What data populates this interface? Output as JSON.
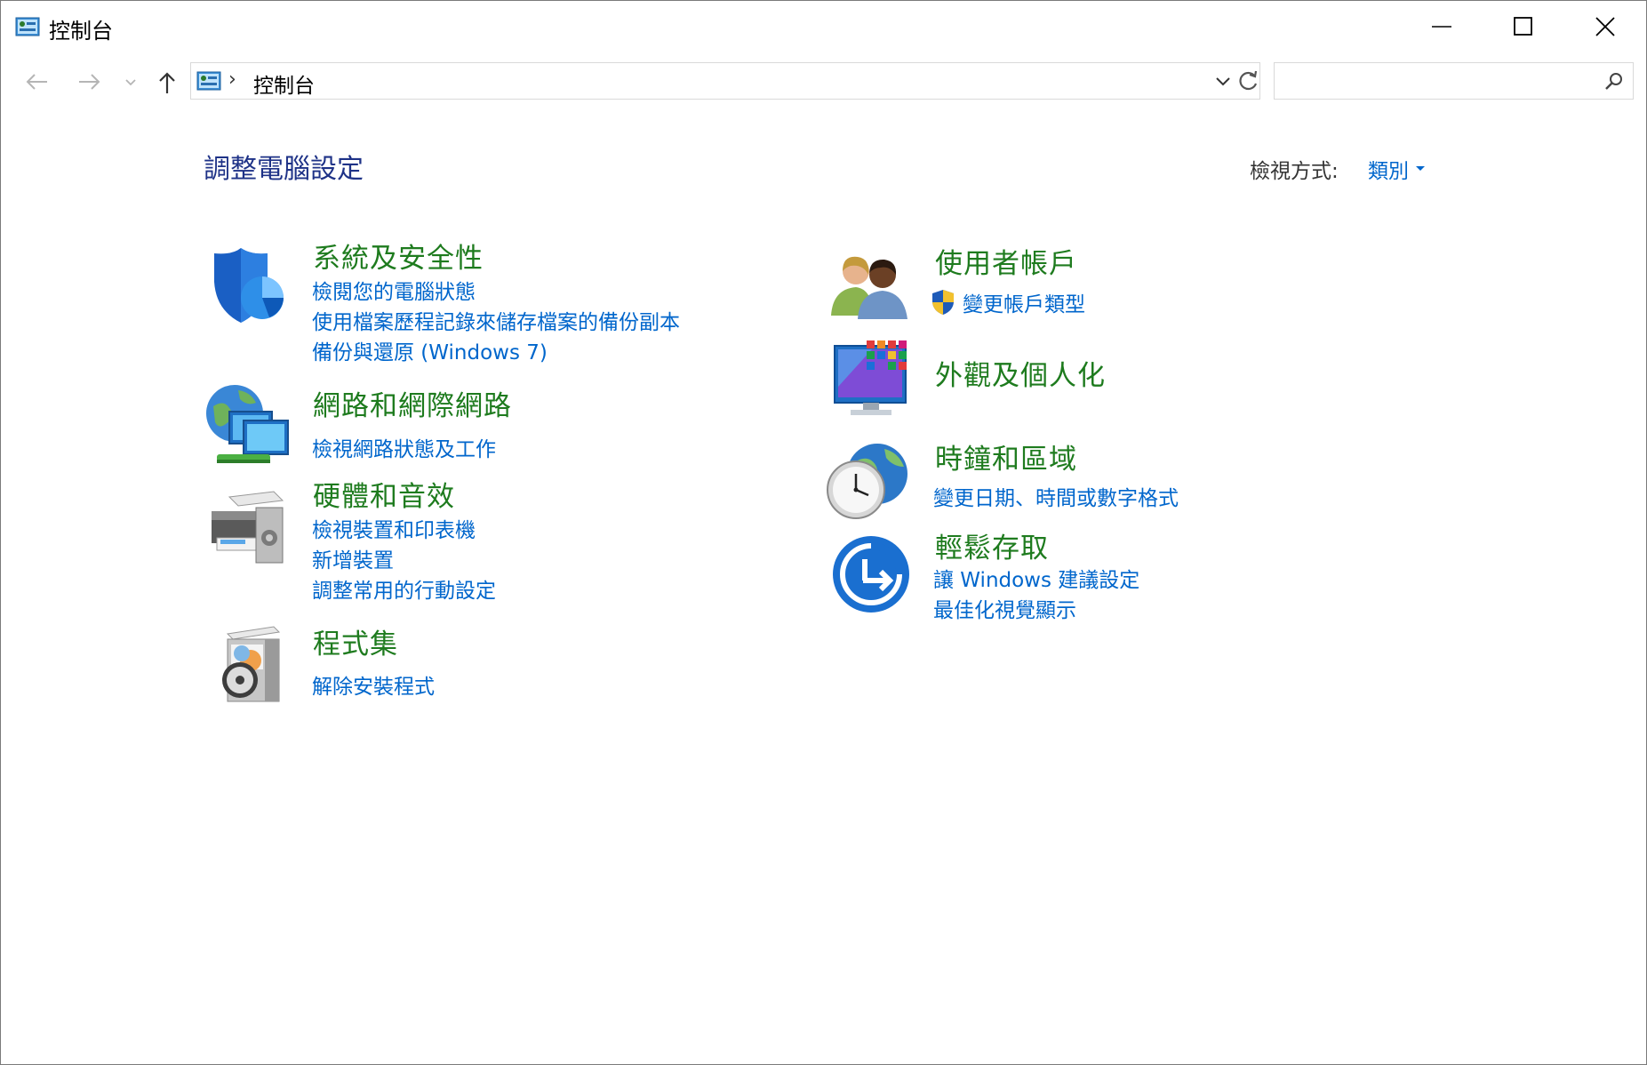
{
  "window": {
    "title": "控制台"
  },
  "address_bar": {
    "path": "控制台"
  },
  "search": {
    "placeholder": "",
    "value": ""
  },
  "header": {
    "page_title": "調整電腦設定",
    "view_by_label": "檢視方式:",
    "view_by_value": "類別"
  },
  "categories": {
    "system": {
      "title": "系統及安全性",
      "links": [
        "檢閱您的電腦狀態",
        "使用檔案歷程記錄來儲存檔案的備份副本",
        "備份與還原 (Windows 7)"
      ]
    },
    "network": {
      "title": "網路和網際網路",
      "links": [
        "檢視網路狀態及工作"
      ]
    },
    "hardware": {
      "title": "硬體和音效",
      "links": [
        "檢視裝置和印表機",
        "新增裝置",
        "調整常用的行動設定"
      ]
    },
    "programs": {
      "title": "程式集",
      "links": [
        "解除安裝程式"
      ]
    },
    "users": {
      "title": "使用者帳戶",
      "links": [
        "變更帳戶類型"
      ]
    },
    "appearance": {
      "title": "外觀及個人化",
      "links": []
    },
    "clock": {
      "title": "時鐘和區域",
      "links": [
        "變更日期、時間或數字格式"
      ]
    },
    "ease": {
      "title": "輕鬆存取",
      "links": [
        "讓 Windows 建議設定",
        "最佳化視覺顯示"
      ]
    }
  },
  "colors": {
    "category_title": "#1e7b1e",
    "link": "#0066cc",
    "page_title": "#1e3287"
  }
}
